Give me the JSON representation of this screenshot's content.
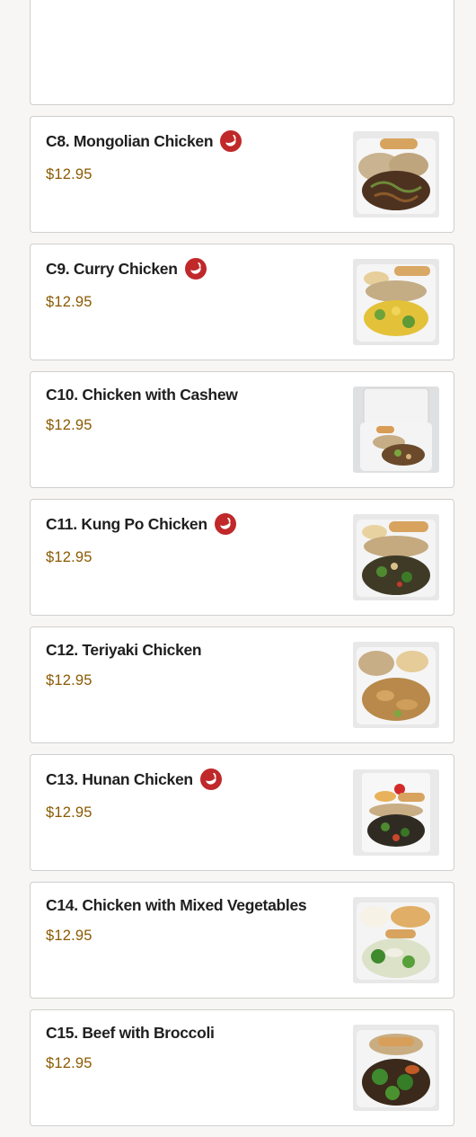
{
  "menu_items": [
    {
      "id": "c7",
      "name": "",
      "price": "",
      "spicy": false,
      "photo": "partial-card-above"
    },
    {
      "id": "c8",
      "name": "C8. Mongolian Chicken",
      "price": "$12.95",
      "spicy": true,
      "photo": "mongolian-chicken-photo"
    },
    {
      "id": "c9",
      "name": "C9. Curry Chicken",
      "price": "$12.95",
      "spicy": true,
      "photo": "curry-chicken-photo"
    },
    {
      "id": "c10",
      "name": "C10. Chicken with Cashew",
      "price": "$12.95",
      "spicy": false,
      "photo": "cashew-chicken-photo"
    },
    {
      "id": "c11",
      "name": "C11. Kung Po Chicken",
      "price": "$12.95",
      "spicy": true,
      "photo": "kung-po-chicken-photo"
    },
    {
      "id": "c12",
      "name": "C12. Teriyaki Chicken",
      "price": "$12.95",
      "spicy": false,
      "photo": "teriyaki-chicken-photo"
    },
    {
      "id": "c13",
      "name": "C13. Hunan Chicken",
      "price": "$12.95",
      "spicy": true,
      "photo": "hunan-chicken-photo"
    },
    {
      "id": "c14",
      "name": "C14. Chicken with Mixed Vegetables",
      "price": "$12.95",
      "spicy": false,
      "photo": "mixed-vegetables-chicken-photo"
    },
    {
      "id": "c15",
      "name": "C15. Beef with Broccoli",
      "price": "$12.95",
      "spicy": false,
      "photo": "beef-broccoli-photo"
    }
  ],
  "colors": {
    "spicy_icon": "#c0282a",
    "price_text": "#8a5a00",
    "title_text": "#1f1f1f",
    "card_border": "#cfcfcf"
  }
}
